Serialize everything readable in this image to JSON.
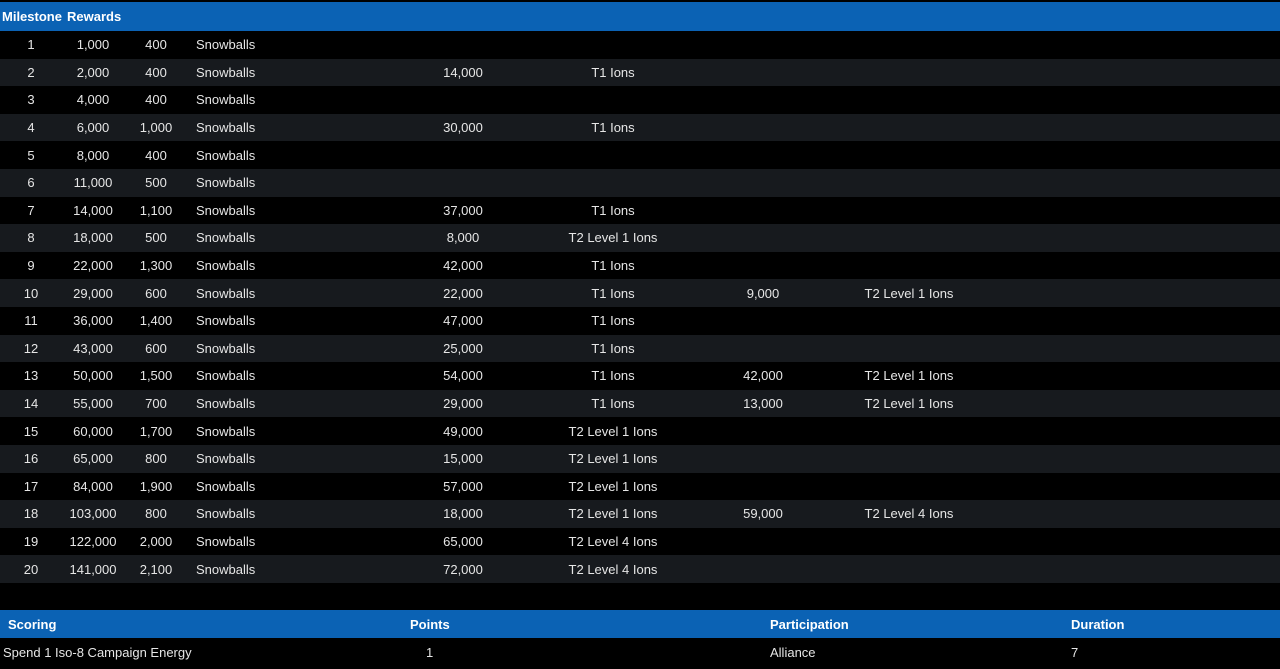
{
  "milestones": {
    "header": {
      "milestone": "Milestone",
      "rewards": "Rewards"
    },
    "rows": [
      [
        "1",
        "1,000",
        "400",
        "Snowballs",
        "",
        "",
        "",
        ""
      ],
      [
        "2",
        "2,000",
        "400",
        "Snowballs",
        "14,000",
        "T1 Ions",
        "",
        ""
      ],
      [
        "3",
        "4,000",
        "400",
        "Snowballs",
        "",
        "",
        "",
        ""
      ],
      [
        "4",
        "6,000",
        "1,000",
        "Snowballs",
        "30,000",
        "T1 Ions",
        "",
        ""
      ],
      [
        "5",
        "8,000",
        "400",
        "Snowballs",
        "",
        "",
        "",
        ""
      ],
      [
        "6",
        "11,000",
        "500",
        "Snowballs",
        "",
        "",
        "",
        ""
      ],
      [
        "7",
        "14,000",
        "1,100",
        "Snowballs",
        "37,000",
        "T1 Ions",
        "",
        ""
      ],
      [
        "8",
        "18,000",
        "500",
        "Snowballs",
        "8,000",
        "T2 Level 1 Ions",
        "",
        ""
      ],
      [
        "9",
        "22,000",
        "1,300",
        "Snowballs",
        "42,000",
        "T1 Ions",
        "",
        ""
      ],
      [
        "10",
        "29,000",
        "600",
        "Snowballs",
        "22,000",
        "T1 Ions",
        "9,000",
        "T2 Level 1 Ions"
      ],
      [
        "11",
        "36,000",
        "1,400",
        "Snowballs",
        "47,000",
        "T1 Ions",
        "",
        ""
      ],
      [
        "12",
        "43,000",
        "600",
        "Snowballs",
        "25,000",
        "T1 Ions",
        "",
        ""
      ],
      [
        "13",
        "50,000",
        "1,500",
        "Snowballs",
        "54,000",
        "T1 Ions",
        "42,000",
        "T2 Level 1 Ions"
      ],
      [
        "14",
        "55,000",
        "700",
        "Snowballs",
        "29,000",
        "T1 Ions",
        "13,000",
        "T2 Level 1 Ions"
      ],
      [
        "15",
        "60,000",
        "1,700",
        "Snowballs",
        "49,000",
        "T2 Level 1 Ions",
        "",
        ""
      ],
      [
        "16",
        "65,000",
        "800",
        "Snowballs",
        "15,000",
        "T2 Level 1 Ions",
        "",
        ""
      ],
      [
        "17",
        "84,000",
        "1,900",
        "Snowballs",
        "57,000",
        "T2 Level 1 Ions",
        "",
        ""
      ],
      [
        "18",
        "103,000",
        "800",
        "Snowballs",
        "18,000",
        "T2 Level 1 Ions",
        "59,000",
        "T2 Level 4 Ions"
      ],
      [
        "19",
        "122,000",
        "2,000",
        "Snowballs",
        "65,000",
        "T2 Level 4 Ions",
        "",
        ""
      ],
      [
        "20",
        "141,000",
        "2,100",
        "Snowballs",
        "72,000",
        "T2 Level 4 Ions",
        "",
        ""
      ]
    ]
  },
  "scoring": {
    "header": {
      "scoring": "Scoring",
      "points": "Points",
      "participation": "Participation",
      "duration": "Duration"
    },
    "rows": [
      {
        "scoring": "Spend 1 Iso-8 Campaign Energy",
        "points": "1",
        "participation": "Alliance",
        "duration": "7"
      }
    ]
  }
}
